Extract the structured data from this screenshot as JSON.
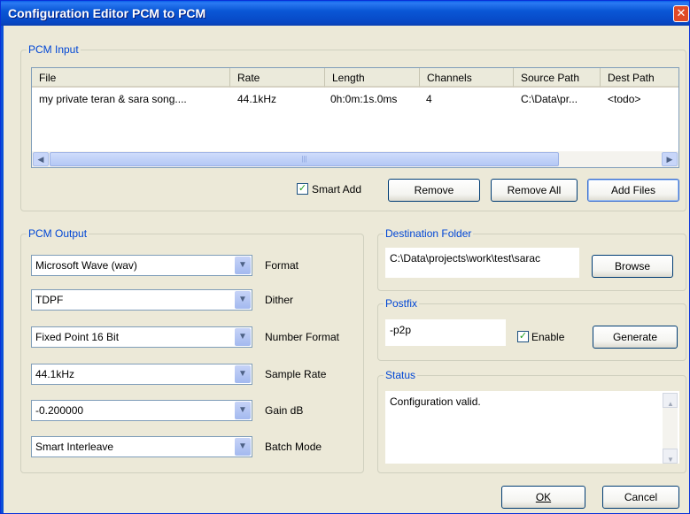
{
  "window": {
    "title": "Configuration Editor PCM to PCM",
    "close_glyph": "✕"
  },
  "pcm_input": {
    "legend": "PCM Input",
    "columns": [
      "File",
      "Rate",
      "Length",
      "Channels",
      "Source Path",
      "Dest Path"
    ],
    "rows": [
      {
        "file": "my private teran & sara song....",
        "rate": "44.1kHz",
        "length": "0h:0m:1s.0ms",
        "channels": "4",
        "source": "C:\\Data\\pr...",
        "dest": "<todo>"
      }
    ],
    "scroll_grip": "|||",
    "smart_add_label": "Smart Add",
    "smart_add_checked": true,
    "remove_label": "Remove",
    "remove_all_label": "Remove All",
    "add_files_label": "Add Files"
  },
  "pcm_output": {
    "legend": "PCM Output",
    "fields": [
      {
        "value": "Microsoft Wave (wav)",
        "label": "Format"
      },
      {
        "value": "TDPF",
        "label": "Dither"
      },
      {
        "value": "Fixed Point 16 Bit",
        "label": "Number Format"
      },
      {
        "value": "44.1kHz",
        "label": "Sample Rate"
      },
      {
        "value": "-0.200000",
        "label": "Gain dB"
      },
      {
        "value": "Smart Interleave",
        "label": "Batch Mode"
      }
    ]
  },
  "destination": {
    "legend": "Destination Folder",
    "path": "C:\\Data\\projects\\work\\test\\sarac",
    "browse_label": "Browse"
  },
  "postfix": {
    "legend": "Postfix",
    "value": "-p2p",
    "enable_label": "Enable",
    "enable_checked": true,
    "generate_label": "Generate"
  },
  "status": {
    "legend": "Status",
    "message": "Configuration valid."
  },
  "footer": {
    "ok_label": "OK",
    "cancel_label": "Cancel"
  }
}
